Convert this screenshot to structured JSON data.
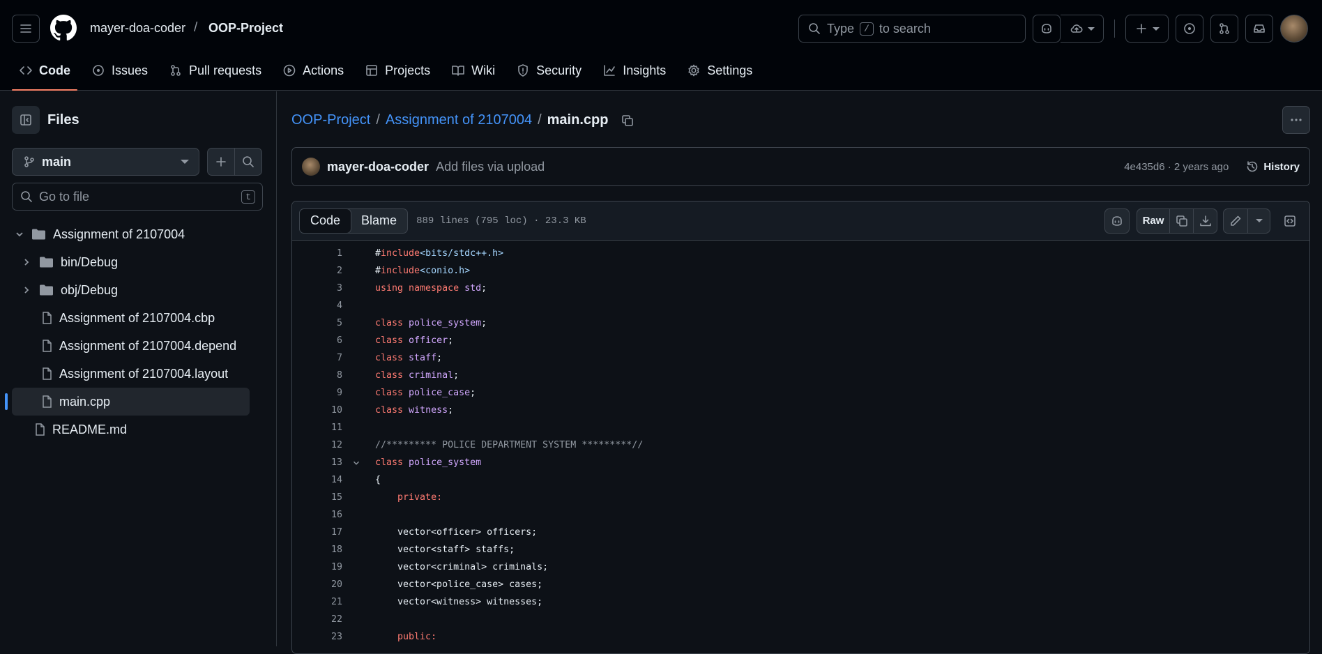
{
  "header": {
    "owner": "mayer-doa-coder",
    "separator": "/",
    "repo": "OOP-Project",
    "search_prefix": "Type",
    "search_key": "/",
    "search_suffix": "to search"
  },
  "repo_nav": [
    {
      "label": "Code",
      "icon": "code-icon"
    },
    {
      "label": "Issues",
      "icon": "issue-opened-icon"
    },
    {
      "label": "Pull requests",
      "icon": "git-pull-request-icon"
    },
    {
      "label": "Actions",
      "icon": "play-icon"
    },
    {
      "label": "Projects",
      "icon": "table-icon"
    },
    {
      "label": "Wiki",
      "icon": "book-icon"
    },
    {
      "label": "Security",
      "icon": "shield-icon"
    },
    {
      "label": "Insights",
      "icon": "graph-icon"
    },
    {
      "label": "Settings",
      "icon": "gear-icon"
    }
  ],
  "sidebar": {
    "title": "Files",
    "branch": "main",
    "goto_placeholder": "Go to file",
    "goto_key": "t",
    "tree": [
      {
        "label": "Assignment of 2107004",
        "type": "folder-open"
      },
      {
        "label": "bin/Debug",
        "type": "folder"
      },
      {
        "label": "obj/Debug",
        "type": "folder"
      },
      {
        "label": "Assignment of 2107004.cbp",
        "type": "file"
      },
      {
        "label": "Assignment of 2107004.depend",
        "type": "file"
      },
      {
        "label": "Assignment of 2107004.layout",
        "type": "file"
      },
      {
        "label": "main.cpp",
        "type": "file",
        "selected": true
      },
      {
        "label": "README.md",
        "type": "file"
      }
    ]
  },
  "breadcrumb": {
    "repo": "OOP-Project",
    "folder": "Assignment of 2107004",
    "file": "main.cpp",
    "sep": "/"
  },
  "commit": {
    "author": "mayer-doa-coder",
    "message": "Add files via upload",
    "meta": "4e435d6 · 2 years ago",
    "history_label": "History"
  },
  "file_header": {
    "code_tab": "Code",
    "blame_tab": "Blame",
    "info": "889 lines (795 loc) · 23.3 KB",
    "raw_label": "Raw"
  },
  "code_lines": [
    {
      "n": "1",
      "text": "#include<bits/stdc++.h>"
    },
    {
      "n": "2",
      "text": "#include<conio.h>"
    },
    {
      "n": "3",
      "text": "using namespace std;"
    },
    {
      "n": "4",
      "text": ""
    },
    {
      "n": "5",
      "text": "class police_system;"
    },
    {
      "n": "6",
      "text": "class officer;"
    },
    {
      "n": "7",
      "text": "class staff;"
    },
    {
      "n": "8",
      "text": "class criminal;"
    },
    {
      "n": "9",
      "text": "class police_case;"
    },
    {
      "n": "10",
      "text": "class witness;"
    },
    {
      "n": "11",
      "text": ""
    },
    {
      "n": "12",
      "text": "//********* POLICE DEPARTMENT SYSTEM *********//"
    },
    {
      "n": "13",
      "text": "class police_system",
      "fold": true
    },
    {
      "n": "14",
      "text": "{"
    },
    {
      "n": "15",
      "text": "    private:"
    },
    {
      "n": "16",
      "text": ""
    },
    {
      "n": "17",
      "text": "    vector<officer> officers;"
    },
    {
      "n": "18",
      "text": "    vector<staff> staffs;"
    },
    {
      "n": "19",
      "text": "    vector<criminal> criminals;"
    },
    {
      "n": "20",
      "text": "    vector<police_case> cases;"
    },
    {
      "n": "21",
      "text": "    vector<witness> witnesses;"
    },
    {
      "n": "22",
      "text": ""
    },
    {
      "n": "23",
      "text": "    public:"
    }
  ],
  "colors": {
    "background": "#0d1117",
    "header_bg": "#010409",
    "link": "#4493f8",
    "active_tab_underline": "#f78166",
    "keyword": "#ff7b72",
    "type_name": "#d2a8ff",
    "include_path": "#a5d6ff"
  }
}
